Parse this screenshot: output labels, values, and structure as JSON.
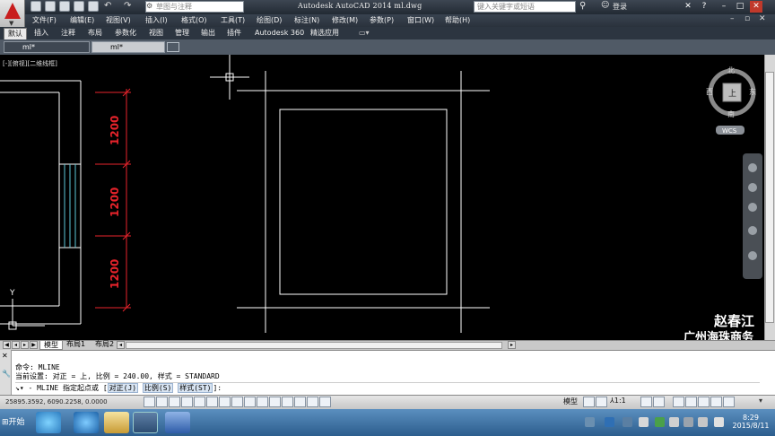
{
  "window": {
    "app_title": "Autodesk AutoCAD 2014    ml.dwg",
    "workspace": "草图与注释",
    "search_placeholder": "键入关键字或短语",
    "login": "登录"
  },
  "menu": [
    "文件(F)",
    "编辑(E)",
    "视图(V)",
    "插入(I)",
    "格式(O)",
    "工具(T)",
    "绘图(D)",
    "标注(N)",
    "修改(M)",
    "参数(P)",
    "窗口(W)",
    "帮助(H)"
  ],
  "ribbon_tabs": {
    "default": "默认",
    "others": [
      "插入",
      "注释",
      "布局",
      "参数化",
      "视图",
      "管理",
      "输出",
      "插件",
      "Autodesk 360",
      "精选应用"
    ]
  },
  "file_tabs": [
    "ml*",
    "ml*"
  ],
  "viewport": {
    "control": "[-][俯视][二维线框]",
    "dimensions": [
      "1200",
      "1200",
      "1200"
    ],
    "ucs_y": "Y",
    "viewcube": {
      "north": "北",
      "south": "南",
      "east": "东",
      "west": "西",
      "face": "上",
      "wcs": "WCS"
    },
    "watermark_1": "赵春江",
    "watermark_2": "广州海珠商务"
  },
  "layout_tabs": [
    "模型",
    "布局1",
    "布局2"
  ],
  "command": {
    "line1": "命令:  MLINE",
    "line2": "当前设置: 对正 = 上, 比例 = 240.00, 样式 = STANDARD",
    "prompt_prefix": "- MLINE 指定起点或",
    "opt1": "对正(J)",
    "opt2": "比例(S)",
    "opt3": "样式(ST)",
    "prompt_suffix": "]:"
  },
  "status": {
    "coords": "25895.3592, 6090.2258, 0.0000",
    "model": "模型",
    "scale": "1:1"
  },
  "taskbar": {
    "start": "开始",
    "time": "8:29",
    "date": "2015/8/11"
  },
  "colors": {
    "dimension": "#e8232b",
    "geometry": "#ffffff",
    "window_text": "#5ec8d8",
    "titlebar": "#2b333d"
  }
}
